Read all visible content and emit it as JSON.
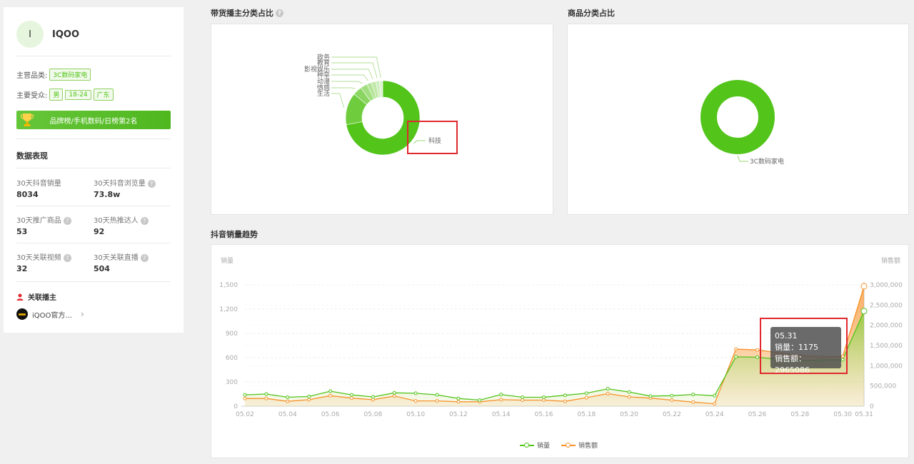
{
  "brand": {
    "avatar_letter": "I",
    "name": "IQOO"
  },
  "profile": {
    "main_category_label": "主营品类:",
    "main_category_tag": "3C数码家电",
    "audience_label": "主要受众:",
    "audience_tags": [
      "男",
      "18-24",
      "广东"
    ],
    "rank_banner": "品牌榜/手机数码/日榜第2名"
  },
  "data_section": {
    "title": "数据表现",
    "metrics": [
      {
        "label": "30天抖音销量",
        "value": "8034",
        "help": false
      },
      {
        "label": "30天抖音浏览量",
        "value": "73.8w",
        "help": true
      },
      {
        "label": "30天推广商品",
        "value": "53",
        "help": true
      },
      {
        "label": "30天热推达人",
        "value": "92",
        "help": true
      },
      {
        "label": "30天关联视频",
        "value": "32",
        "help": true
      },
      {
        "label": "30天关联直播",
        "value": "504",
        "help": true
      }
    ],
    "help_glyph": "?"
  },
  "anchor_section": {
    "title": "关联播主",
    "item_name": "iQOO官方...",
    "chevron": "›"
  },
  "panels": {
    "anchor_category_title": "带货播主分类占比",
    "product_category_title": "商品分类占比",
    "trend_title": "抖音销量趋势"
  },
  "colors": {
    "green": "#52c41a",
    "orange": "#f7922b",
    "red_highlight": "#e0282e"
  },
  "chart_data": [
    {
      "type": "pie",
      "title": "带货播主分类占比",
      "labels": [
        "科技",
        "生活",
        "情感",
        "动漫",
        "种草",
        "影视娱乐",
        "教育",
        "政务"
      ],
      "values": [
        72,
        14,
        4,
        3,
        2,
        2,
        1.5,
        1.5
      ]
    },
    {
      "type": "pie",
      "title": "商品分类占比",
      "labels": [
        "3C数码家电"
      ],
      "values": [
        100
      ]
    },
    {
      "type": "line",
      "title": "抖音销量趋势",
      "x": [
        "05.02",
        "05.03",
        "05.04",
        "05.05",
        "05.06",
        "05.07",
        "05.08",
        "05.09",
        "05.10",
        "05.11",
        "05.12",
        "05.13",
        "05.14",
        "05.15",
        "05.16",
        "05.17",
        "05.18",
        "05.19",
        "05.20",
        "05.21",
        "05.22",
        "05.23",
        "05.24",
        "05.25",
        "05.26",
        "05.27",
        "05.28",
        "05.29",
        "05.30",
        "05.31"
      ],
      "x_ticks": [
        "05.02",
        "05.04",
        "05.06",
        "05.08",
        "05.10",
        "05.12",
        "05.14",
        "05.16",
        "05.18",
        "05.20",
        "05.22",
        "05.24",
        "05.26",
        "05.28",
        "05.30",
        "05.31"
      ],
      "ylabel": "销量",
      "ylabel_right": "销售额",
      "ylim": [
        0,
        1500
      ],
      "yticks": [
        "0",
        "300",
        "600",
        "900",
        "1,200",
        "1,500"
      ],
      "ylim_right": [
        0,
        3000000
      ],
      "yticks_right": [
        "0",
        "500,000",
        "1,000,000",
        "1,500,000",
        "2,000,000",
        "2,500,000",
        "3,000,000"
      ],
      "series": [
        {
          "name": "销量",
          "axis": "left",
          "color": "#52c41a",
          "values": [
            140,
            150,
            110,
            120,
            185,
            140,
            115,
            165,
            160,
            140,
            95,
            75,
            145,
            110,
            110,
            135,
            160,
            215,
            175,
            125,
            130,
            145,
            130,
            610,
            605,
            580,
            560,
            570,
            575,
            1175
          ]
        },
        {
          "name": "销售额",
          "axis": "right",
          "color": "#f7922b",
          "values": [
            190000,
            190000,
            120000,
            160000,
            260000,
            200000,
            160000,
            250000,
            130000,
            130000,
            110000,
            110000,
            160000,
            150000,
            150000,
            120000,
            210000,
            310000,
            230000,
            200000,
            150000,
            100000,
            60000,
            1410000,
            1390000,
            1320000,
            1250000,
            1220000,
            1230000,
            2965086
          ]
        }
      ],
      "tooltip": {
        "date": "05.31",
        "sales_label": "销量：",
        "sales_value": "1175",
        "amount_label": "销售额：",
        "amount_value": "2965086"
      }
    }
  ]
}
